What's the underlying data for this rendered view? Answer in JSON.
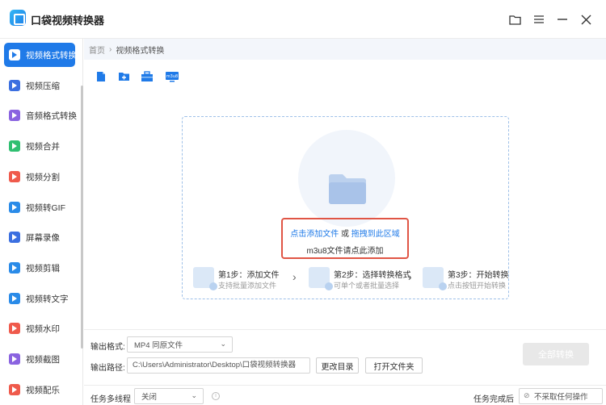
{
  "app": {
    "title": "口袋视频转换器"
  },
  "window": {
    "folder_icon": "folder-icon",
    "menu_icon": "menu-icon",
    "minimize": "—",
    "close": "✕"
  },
  "sidebar": {
    "items": [
      {
        "label": "视频格式转换",
        "color": "#1f7ae8",
        "active": true
      },
      {
        "label": "视频压缩",
        "color": "#3b6fe0"
      },
      {
        "label": "音频格式转换",
        "color": "#8a63e0"
      },
      {
        "label": "视频合并",
        "color": "#2fbf71"
      },
      {
        "label": "视频分割",
        "color": "#ef5a4c"
      },
      {
        "label": "视频转GIF",
        "color": "#2a8be8"
      },
      {
        "label": "屏幕录像",
        "color": "#3b6fe0"
      },
      {
        "label": "视频剪辑",
        "color": "#2a8be8"
      },
      {
        "label": "视频转文字",
        "color": "#2a8be8"
      },
      {
        "label": "视频水印",
        "color": "#ef5a4c"
      },
      {
        "label": "视频截图",
        "color": "#8a63e0"
      },
      {
        "label": "视频配乐",
        "color": "#ef5a4c"
      }
    ]
  },
  "breadcrumb": {
    "home": "首页",
    "separator": "›",
    "current": "视频格式转换"
  },
  "toolbar": {
    "m3u8_label": "m3u8"
  },
  "dropzone": {
    "add_file": "点击添加文件",
    "or": " 或 ",
    "drag_here": "拖拽到此区域",
    "m3u8_hint": "m3u8文件请点此添加"
  },
  "steps": [
    {
      "title": "第1步：添加文件",
      "sub": "支持批量添加文件"
    },
    {
      "title": "第2步：选择转换格式",
      "sub": "可单个或者批量选择"
    },
    {
      "title": "第3步：开始转换",
      "sub": "点击按钮开始转换"
    }
  ],
  "step_arrow": "›",
  "output": {
    "format_label": "输出格式:",
    "format_value": "MP4  同原文件",
    "path_label": "输出路径:",
    "path_value": "C:\\Users\\Administrator\\Desktop\\口袋视频转换器",
    "change_dir": "更改目录",
    "open_folder": "打开文件夹",
    "convert_all": "全部转换"
  },
  "footer": {
    "multithread_label": "任务多线程",
    "multithread_value": "关闭",
    "after_label": "任务完成后",
    "after_value": "不采取任何操作"
  }
}
